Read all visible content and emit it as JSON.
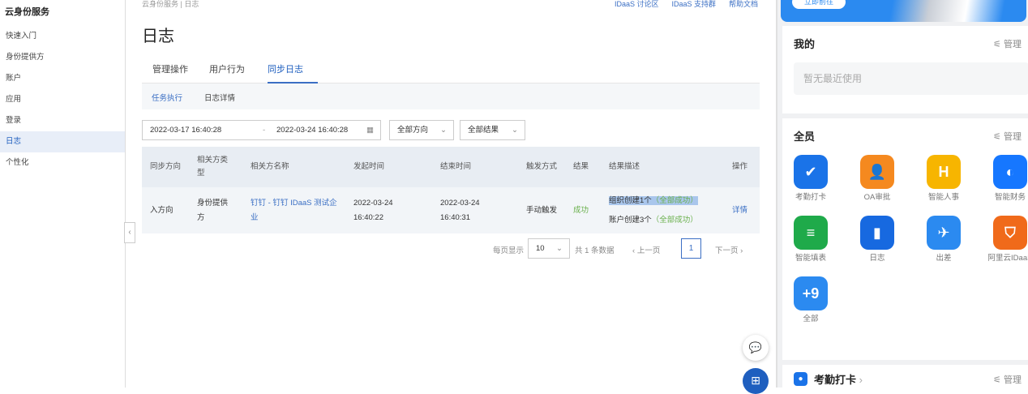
{
  "sidebar": {
    "title": "云身份服务",
    "items": [
      "快速入门",
      "身份提供方",
      "账户",
      "应用",
      "登录",
      "日志",
      "个性化"
    ],
    "active": "日志"
  },
  "breadcrumb": {
    "root": "云身份服务",
    "current": "日志"
  },
  "top_links": [
    "IDaaS 讨论区",
    "IDaaS 支持群",
    "帮助文档"
  ],
  "page_title": "日志",
  "tabs": [
    "管理操作",
    "用户行为",
    "同步日志"
  ],
  "subtabs": [
    "任务执行",
    "日志详情"
  ],
  "filters": {
    "start": "2022-03-17 16:40:28",
    "sep": "-",
    "end": "2022-03-24 16:40:28",
    "direction": "全部方向",
    "result": "全部结果"
  },
  "table": {
    "headers": [
      "同步方向",
      "相关方类型",
      "相关方名称",
      "发起时间",
      "结束时间",
      "触发方式",
      "结果",
      "结果描述",
      "操作"
    ],
    "rows": [
      {
        "direction": "入方向",
        "type": "身份提供方",
        "name": "钉钉 - 钉钉 IDaaS 测试企业",
        "start": "2022-03-24 16:40:22",
        "end": "2022-03-24 16:40:31",
        "trigger": "手动触发",
        "result": "成功",
        "desc1": "组织创建1个",
        "desc1_status": "（全部成功）",
        "desc2": "账户创建3个",
        "desc2_status": "（全部成功）",
        "action": "详情"
      }
    ]
  },
  "pager": {
    "per_page_label": "每页显示",
    "per_page": "10",
    "total": "共 1 条数据",
    "prev": "上一页",
    "page": "1",
    "next": "下一页"
  },
  "right": {
    "banner_button": "立即前往",
    "mine": "我的",
    "manage": "管理",
    "empty": "暂无最近使用",
    "all_staff": "全员",
    "apps": [
      {
        "label": "考勤打卡",
        "color": "#1a73e8",
        "glyph": "✔"
      },
      {
        "label": "OA审批",
        "color": "#f5891f",
        "glyph": "👤"
      },
      {
        "label": "智能人事",
        "color": "#f7b500",
        "glyph": "H"
      },
      {
        "label": "智能财务",
        "color": "#1677ff",
        "glyph": "◐"
      },
      {
        "label": "智能填表",
        "color": "#1faa4a",
        "glyph": "≡"
      },
      {
        "label": "日志",
        "color": "#1769e0",
        "glyph": "▮"
      },
      {
        "label": "出差",
        "color": "#2b8af0",
        "glyph": "✈"
      },
      {
        "label": "阿里云IDaaS",
        "color": "#f06a1a",
        "glyph": "⛉"
      },
      {
        "label": "全部",
        "color": "#2b8af0",
        "glyph": "+9"
      }
    ],
    "bottom_title": "考勤打卡"
  }
}
